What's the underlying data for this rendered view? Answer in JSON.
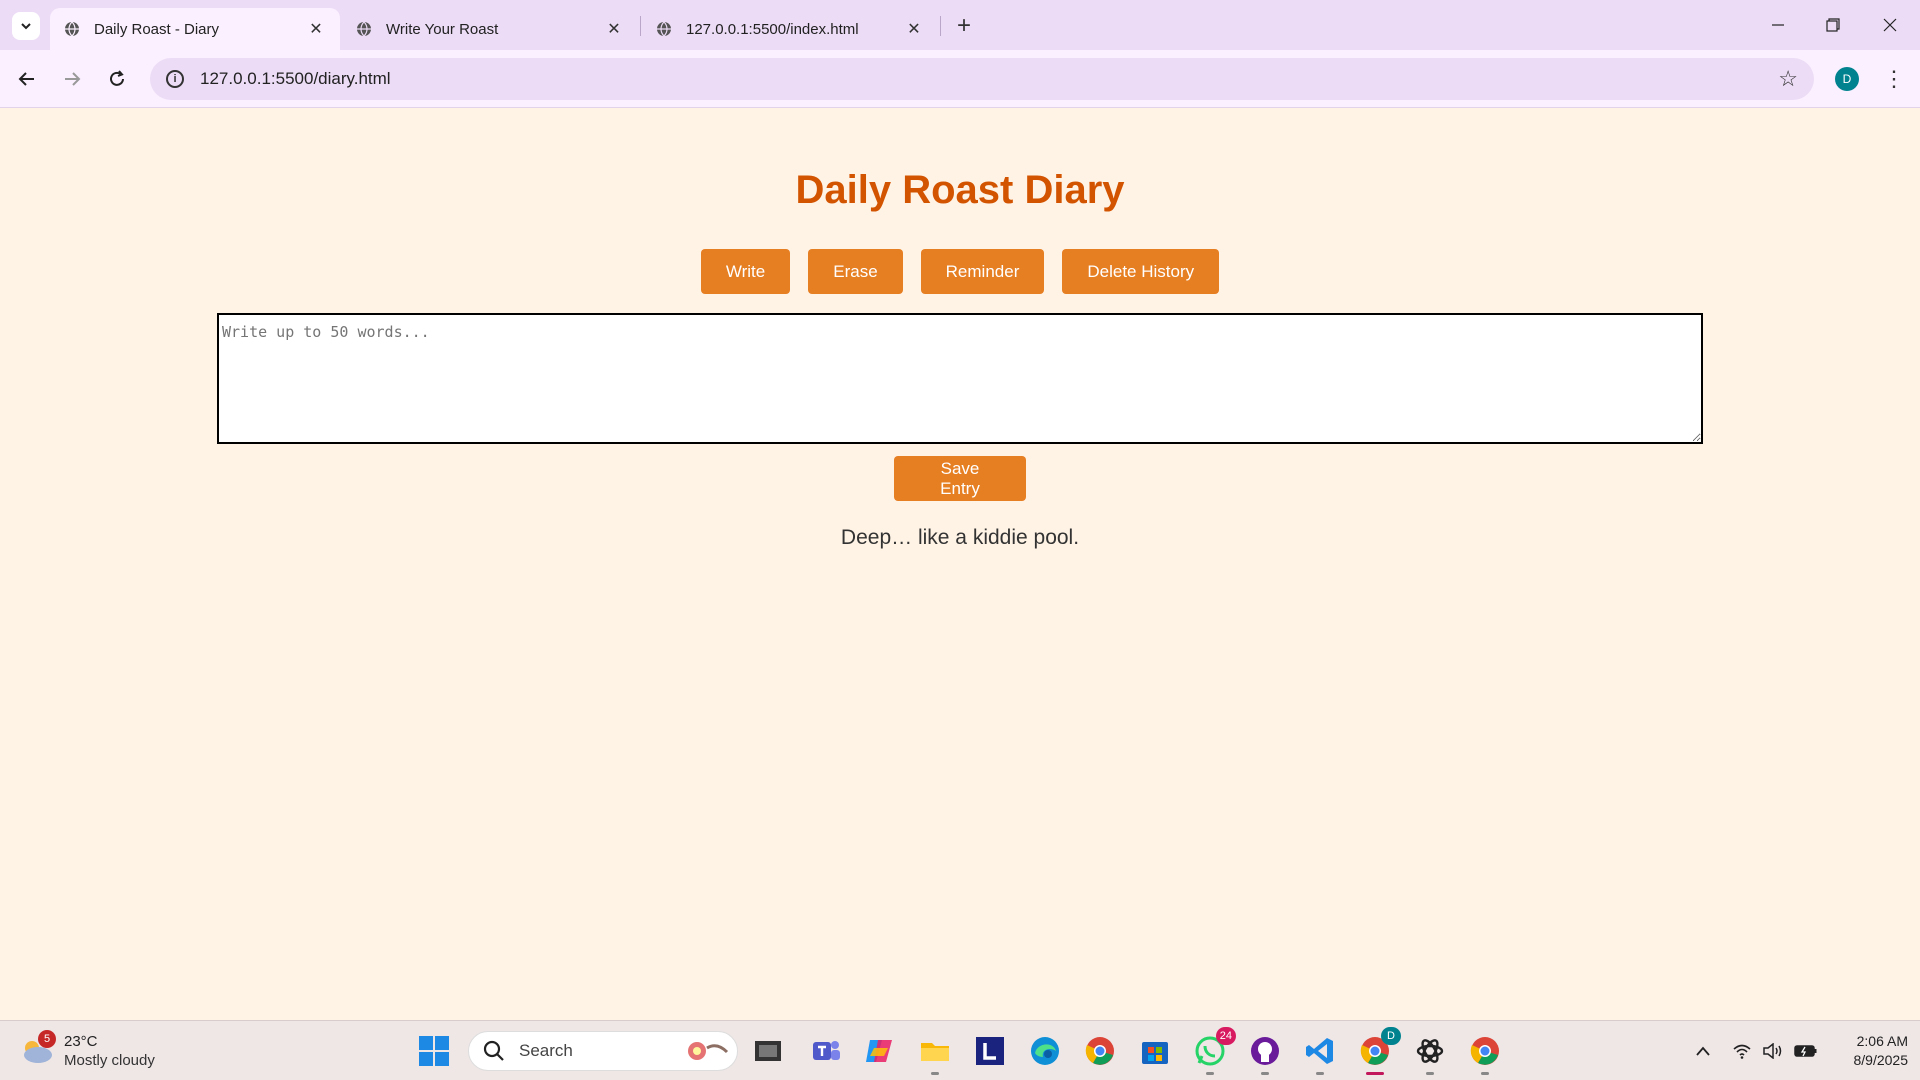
{
  "browser": {
    "tabs": [
      {
        "title": "Daily Roast - Diary",
        "active": true
      },
      {
        "title": "Write Your Roast",
        "active": false
      },
      {
        "title": "127.0.0.1:5500/index.html",
        "active": false
      }
    ],
    "url": "127.0.0.1:5500/diary.html",
    "profile_initial": "D"
  },
  "page": {
    "title": "Daily Roast Diary",
    "buttons": {
      "write": "Write",
      "erase": "Erase",
      "reminder": "Reminder",
      "delete_history": "Delete History"
    },
    "entry_placeholder": "Write up to 50 words...",
    "save_label": "Save Entry",
    "roast_message": "Deep… like a kiddie pool."
  },
  "taskbar": {
    "weather": {
      "temp": "23°C",
      "condition": "Mostly cloudy",
      "badge": "5"
    },
    "search_label": "Search",
    "whatsapp_badge": "24",
    "chrome_profile_badge": "D",
    "clock": {
      "time": "2:06 AM",
      "date": "8/9/2025"
    }
  },
  "colors": {
    "accent": "#e67e22",
    "title": "#d35400",
    "page_bg": "#fff3e6"
  }
}
